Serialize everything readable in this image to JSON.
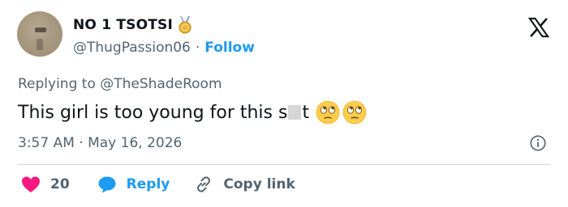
{
  "author": {
    "display_name": "NO 1 TSOTSI",
    "badge_icon": "medal-icon",
    "handle": "@ThugPassion06",
    "separator": "·",
    "follow_label": "Follow"
  },
  "platform_icon": "x-logo-icon",
  "tweet": {
    "replying_to": "Replying to @TheShadeRoom",
    "text_before": "This girl is too young for this s",
    "text_after": "t",
    "emojis": [
      "rolling-eyes-emoji",
      "rolling-eyes-emoji"
    ],
    "timestamp": "3:57 AM · May 16, 2026"
  },
  "actions": {
    "like_count": "20",
    "reply_label": "Reply",
    "copy_link_label": "Copy link"
  },
  "colors": {
    "accent": "#1d9bf0",
    "like": "#f91880",
    "muted_text": "#536471",
    "primary_text": "#0f1419"
  }
}
